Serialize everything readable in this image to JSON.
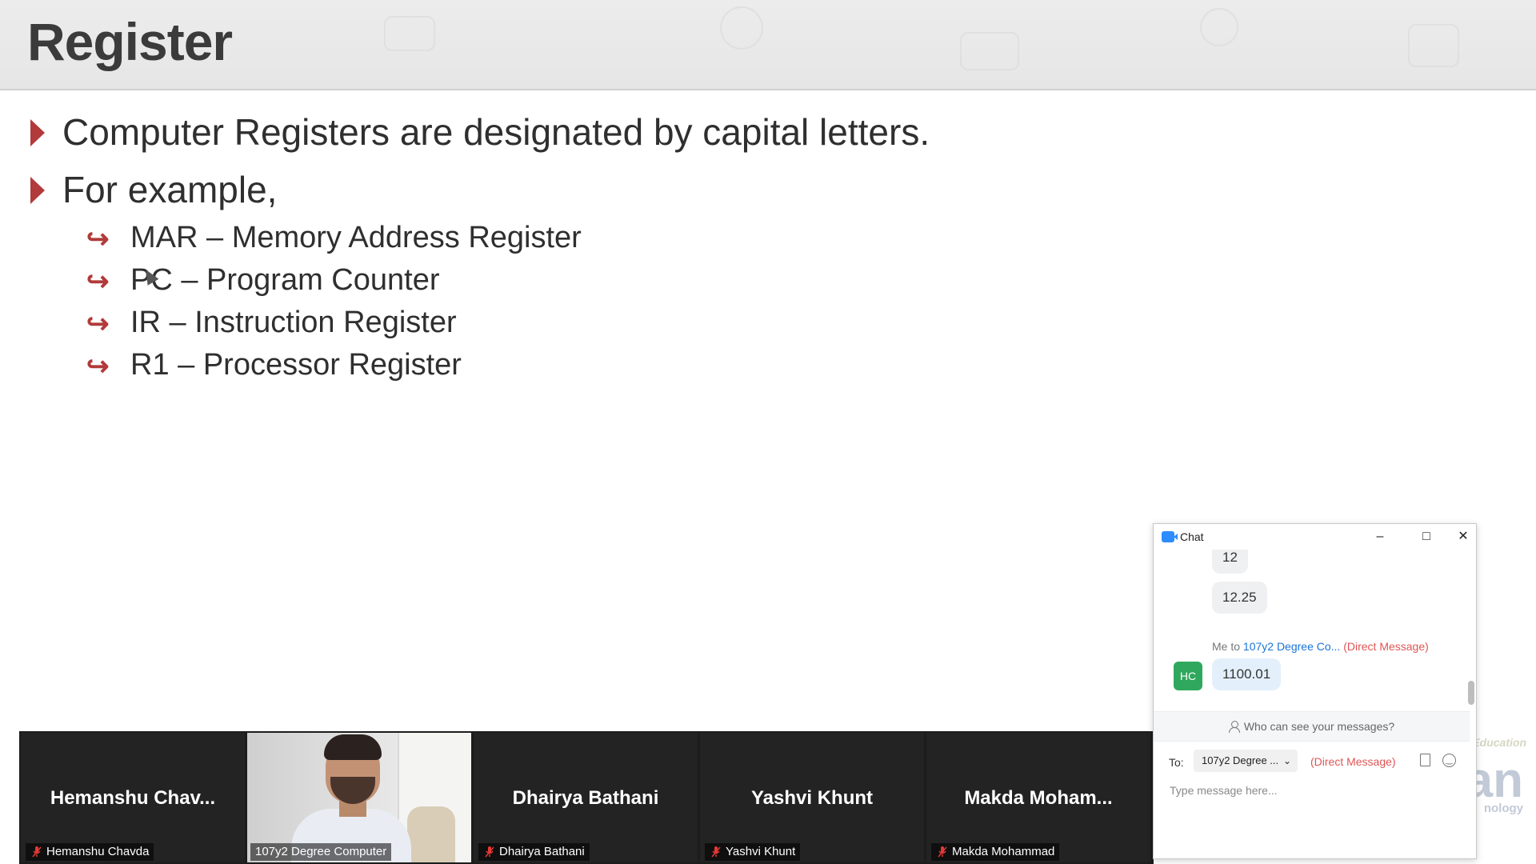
{
  "slide": {
    "title": "Register",
    "bullets": [
      "Computer Registers are designated by capital letters.",
      "For example,"
    ],
    "sub_bullets": [
      "MAR – Memory Address Register",
      "PC – Program Counter",
      "IR – Instruction Register",
      "R1 – Processor Register"
    ],
    "sub_bullet_symbol": "↪",
    "accent_color": "#b23a3a"
  },
  "participants": [
    {
      "display_name": "Hemanshu  Chav...",
      "label": "Hemanshu Chavda",
      "muted": true,
      "video_on": false
    },
    {
      "display_name": "",
      "label": "107y2 Degree Computer",
      "muted": false,
      "video_on": true
    },
    {
      "display_name": "Dhairya Bathani",
      "label": "Dhairya Bathani",
      "muted": true,
      "video_on": false
    },
    {
      "display_name": "Yashvi Khunt",
      "label": "Yashvi Khunt",
      "muted": true,
      "video_on": false
    },
    {
      "display_name": "Makda  Moham...",
      "label": "Makda Mohammad",
      "muted": true,
      "video_on": false
    }
  ],
  "chat": {
    "title": "Chat",
    "messages": [
      "12",
      "12.25"
    ],
    "meta": {
      "prefix": "Me to",
      "recipient": "107y2 Degree Co...",
      "type": "(Direct Message)"
    },
    "my_message": "1100.01",
    "avatar_initials": "HC",
    "privacy_text": "Who can see your messages?",
    "to_label": "To:",
    "recipient_select": "107y2 Degree ...",
    "dm_label": "(Direct Message)",
    "input_placeholder": "Type message here...",
    "colors": {
      "avatar": "#2fa85d",
      "link": "#1a73d9",
      "direct_message": "#e05555",
      "logo": "#2d8cff"
    }
  },
  "watermark": {
    "line1": "Education",
    "line2": "an",
    "line3": "nology"
  }
}
